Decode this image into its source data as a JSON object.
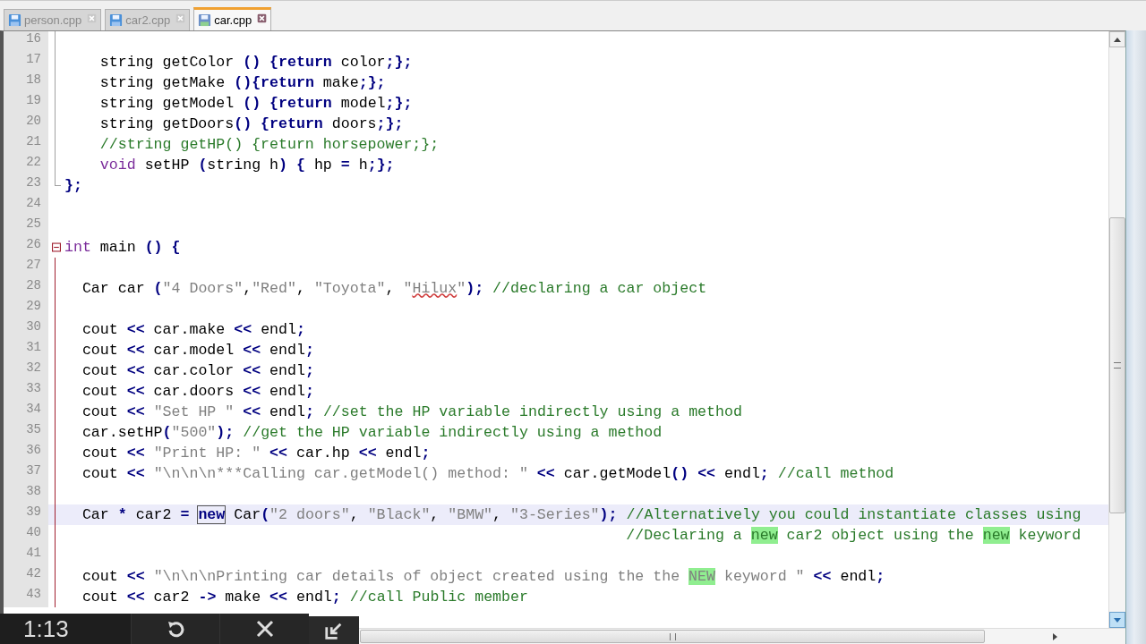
{
  "tabs": [
    {
      "label": "person.cpp",
      "selected": false
    },
    {
      "label": "car2.cpp",
      "selected": false
    },
    {
      "label": "car.cpp",
      "selected": true
    }
  ],
  "editor": {
    "lines": [
      {
        "number": "16",
        "kind": "body",
        "current": false
      },
      {
        "number": "17",
        "kind": "body",
        "current": false,
        "tokens": [
          {
            "kind": "plain",
            "text": "    string getColor () {"
          },
          {
            "kind": "kw",
            "text": "return"
          },
          {
            "kind": "plain",
            "text": " color;};"
          }
        ]
      },
      {
        "number": "18",
        "kind": "body",
        "current": false,
        "tokens": [
          {
            "kind": "plain",
            "text": "    string getMake (){"
          },
          {
            "kind": "kw",
            "text": "return"
          },
          {
            "kind": "plain",
            "text": " make;};"
          }
        ]
      },
      {
        "number": "19",
        "kind": "body",
        "current": false,
        "tokens": [
          {
            "kind": "plain",
            "text": "    string getModel () {"
          },
          {
            "kind": "kw",
            "text": "return"
          },
          {
            "kind": "plain",
            "text": " model;};"
          }
        ]
      },
      {
        "number": "20",
        "kind": "body",
        "current": false,
        "tokens": [
          {
            "kind": "plain",
            "text": "    string getDoors() {"
          },
          {
            "kind": "kw",
            "text": "return"
          },
          {
            "kind": "plain",
            "text": " doors;};"
          }
        ]
      },
      {
        "number": "21",
        "kind": "body",
        "current": false,
        "tokens": [
          {
            "kind": "cmt",
            "text": "    //string getHP() {return horsepower;};"
          }
        ]
      },
      {
        "number": "22",
        "kind": "body",
        "current": false,
        "tokens": [
          {
            "kind": "type",
            "text": "    void"
          },
          {
            "kind": "plain",
            "text": " setHP (string h) { hp = h;};"
          }
        ]
      },
      {
        "number": "23",
        "kind": "end",
        "current": false,
        "tokens": [
          {
            "kind": "plain",
            "text": "};"
          }
        ]
      },
      {
        "number": "24",
        "kind": "plain",
        "current": false
      },
      {
        "number": "25",
        "kind": "plain",
        "current": false
      },
      {
        "number": "26",
        "kind": "start",
        "current": false,
        "tokens": [
          {
            "kind": "type",
            "text": "int"
          },
          {
            "kind": "plain",
            "text": " main () {"
          }
        ]
      },
      {
        "number": "27",
        "kind": "body_active",
        "current": false
      },
      {
        "number": "28",
        "kind": "body_active",
        "current": false,
        "tokens": [
          {
            "kind": "plain",
            "text": "  Car car ("
          },
          {
            "kind": "str",
            "text": "\"4 Doors\""
          },
          {
            "kind": "plain",
            "text": ","
          },
          {
            "kind": "str",
            "text": "\"Red\""
          },
          {
            "kind": "plain",
            "text": ", "
          },
          {
            "kind": "str",
            "text": "\"Toyota\""
          },
          {
            "kind": "plain",
            "text": ", "
          },
          {
            "kind": "str",
            "text": "\""
          },
          {
            "kind": "str_misspelled",
            "text": "Hilux"
          },
          {
            "kind": "str",
            "text": "\""
          },
          {
            "kind": "plain",
            "text": "); "
          },
          {
            "kind": "cmt",
            "text": "//declaring a car object"
          }
        ]
      },
      {
        "number": "29",
        "kind": "body_active",
        "current": false
      },
      {
        "number": "30",
        "kind": "body_active",
        "current": false,
        "tokens": [
          {
            "kind": "plain",
            "text": "  cout << car.make << endl;"
          }
        ]
      },
      {
        "number": "31",
        "kind": "body_active",
        "current": false,
        "tokens": [
          {
            "kind": "plain",
            "text": "  cout << car.model << endl;"
          }
        ]
      },
      {
        "number": "32",
        "kind": "body_active",
        "current": false,
        "tokens": [
          {
            "kind": "plain",
            "text": "  cout << car.color << endl;"
          }
        ]
      },
      {
        "number": "33",
        "kind": "body_active",
        "current": false,
        "tokens": [
          {
            "kind": "plain",
            "text": "  cout << car.doors << endl;"
          }
        ]
      },
      {
        "number": "34",
        "kind": "body_active",
        "current": false,
        "tokens": [
          {
            "kind": "plain",
            "text": "  cout << "
          },
          {
            "kind": "str",
            "text": "\"Set HP \""
          },
          {
            "kind": "plain",
            "text": " << endl; "
          },
          {
            "kind": "cmt",
            "text": "//set the HP variable indirectly using a method"
          }
        ]
      },
      {
        "number": "35",
        "kind": "body_active",
        "current": false,
        "tokens": [
          {
            "kind": "plain",
            "text": "  car.setHP("
          },
          {
            "kind": "str",
            "text": "\"500\""
          },
          {
            "kind": "plain",
            "text": "); "
          },
          {
            "kind": "cmt",
            "text": "//get the HP variable indirectly using a method"
          }
        ]
      },
      {
        "number": "36",
        "kind": "body_active",
        "current": false,
        "tokens": [
          {
            "kind": "plain",
            "text": "  cout << "
          },
          {
            "kind": "str",
            "text": "\"Print HP: \""
          },
          {
            "kind": "plain",
            "text": " << car.hp << endl;"
          }
        ]
      },
      {
        "number": "37",
        "kind": "body_active",
        "current": false,
        "tokens": [
          {
            "kind": "plain",
            "text": "  cout << "
          },
          {
            "kind": "str",
            "text": "\"\\n\\n\\n***Calling car.getModel() method: \""
          },
          {
            "kind": "plain",
            "text": " << car.getModel() << endl; "
          },
          {
            "kind": "cmt",
            "text": "//call method"
          }
        ]
      },
      {
        "number": "38",
        "kind": "body_active",
        "current": false
      },
      {
        "number": "39",
        "kind": "body_active",
        "current": true,
        "tokens": [
          {
            "kind": "plain",
            "text": "  Car * car2 = "
          },
          {
            "kind": "word_mark",
            "text": "new"
          },
          {
            "kind": "plain",
            "text": " Car("
          },
          {
            "kind": "str",
            "text": "\"2 doors\""
          },
          {
            "kind": "plain",
            "text": ", "
          },
          {
            "kind": "str",
            "text": "\"Black\""
          },
          {
            "kind": "plain",
            "text": ", "
          },
          {
            "kind": "str",
            "text": "\"BMW\""
          },
          {
            "kind": "plain",
            "text": ", "
          },
          {
            "kind": "str",
            "text": "\"3-Series\""
          },
          {
            "kind": "plain",
            "text": "); "
          },
          {
            "kind": "cmt",
            "text": "//Alternatively you could instantiate classes using"
          }
        ]
      },
      {
        "number": "40",
        "kind": "body_active",
        "current": false,
        "tokens": [
          {
            "kind": "cmt",
            "text": "                                                               //Declaring a "
          },
          {
            "kind": "cmt_match",
            "text": "new"
          },
          {
            "kind": "cmt",
            "text": " car2 object using the "
          },
          {
            "kind": "cmt_match",
            "text": "new"
          },
          {
            "kind": "cmt",
            "text": " keyword"
          }
        ]
      },
      {
        "number": "41",
        "kind": "body_active",
        "current": false
      },
      {
        "number": "42",
        "kind": "body_active",
        "current": false,
        "tokens": [
          {
            "kind": "plain",
            "text": "  cout << "
          },
          {
            "kind": "str",
            "text": "\"\\n\\n\\nPrinting car details of object created using the the "
          },
          {
            "kind": "str_match",
            "text": "NEW"
          },
          {
            "kind": "str",
            "text": " keyword \""
          },
          {
            "kind": "plain",
            "text": " << endl;"
          }
        ]
      },
      {
        "number": "43",
        "kind": "body_active",
        "current": false,
        "tokens": [
          {
            "kind": "plain",
            "text": "  cout << car2 -> make << endl; "
          },
          {
            "kind": "cmt",
            "text": "//call Public member"
          }
        ]
      }
    ]
  },
  "video_controls": {
    "time": "1:13"
  }
}
